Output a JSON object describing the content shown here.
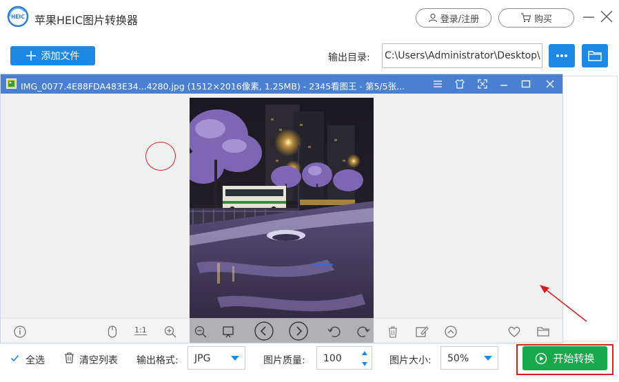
{
  "app": {
    "title": "苹果HEIC图片转换器",
    "logo_text": "HEIC",
    "login_label": "登录/注册",
    "buy_label": "购买"
  },
  "toolbar": {
    "add_file_label": "添加文件",
    "output_dir_label": "输出目录:",
    "output_dir_value": "C:\\Users\\Administrator\\Desktop\\"
  },
  "viewer": {
    "title": "IMG_0077.4E88FDA483E34...4280.jpg  (1512×2016像素, 1.25MB)  - 2345看图王 - 第5/5张...",
    "ratio_label": "1:1"
  },
  "bottom": {
    "select_all_label": "全选",
    "select_all_checked": true,
    "clear_list_label": "清空列表",
    "format_label": "输出格式:",
    "format_value": "JPG",
    "quality_label": "图片质量:",
    "quality_value": "100",
    "size_label": "图片大小:",
    "size_value": "50%",
    "start_label": "开始转换"
  },
  "colors": {
    "accent": "#1e88e5",
    "viewer_title_bg": "#4a80d2",
    "start_green": "#18a84b",
    "annotation_red": "#d82020"
  },
  "icons": [
    "user-icon",
    "cart-icon",
    "minimize-icon",
    "close-icon",
    "plus-icon",
    "more-icon",
    "folder-icon",
    "info-icon",
    "mouse-icon",
    "zoom-in-icon",
    "zoom-out-icon",
    "fit-icon",
    "prev-icon",
    "next-icon",
    "rotate-left-icon",
    "rotate-right-icon",
    "delete-icon",
    "edit-icon",
    "up-icon",
    "heart-icon",
    "open-folder-icon",
    "play-circle-icon",
    "trash-icon"
  ]
}
